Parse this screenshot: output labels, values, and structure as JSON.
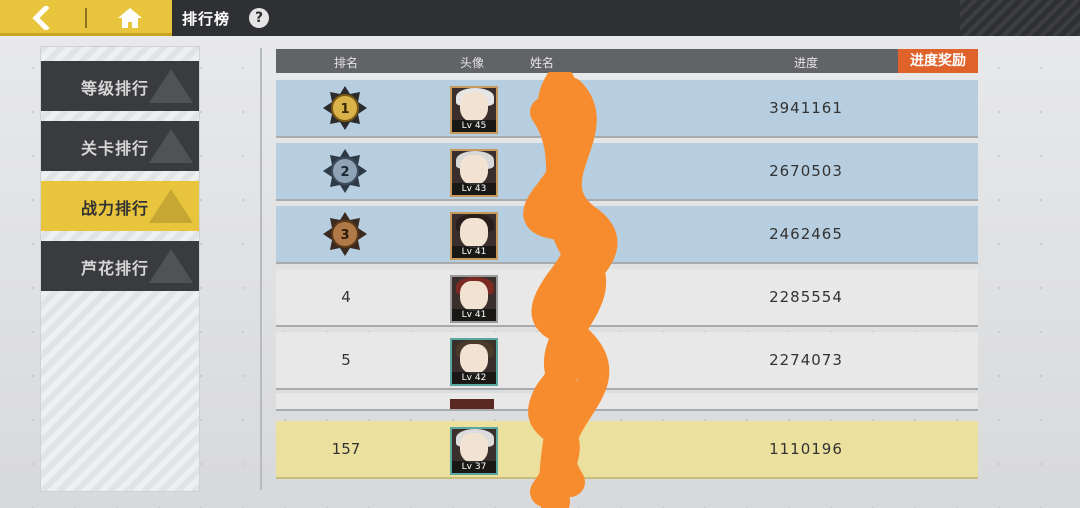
{
  "topbar": {
    "title": "排行榜",
    "help_label": "?",
    "icons": {
      "back": "chevron-left-icon",
      "home": "home-icon"
    }
  },
  "tabs": [
    {
      "label": "等级排行",
      "active": false
    },
    {
      "label": "关卡排行",
      "active": false
    },
    {
      "label": "战力排行",
      "active": true
    },
    {
      "label": "芦花排行",
      "active": false
    }
  ],
  "table": {
    "headers": {
      "rank": "排名",
      "avatar": "头像",
      "name": "姓名",
      "progress": "进度"
    },
    "reward_button": "进度奖励",
    "rows": [
      {
        "rank": "1",
        "medal": "gold",
        "level": "Lv 45",
        "score": "3941161"
      },
      {
        "rank": "2",
        "medal": "silver",
        "level": "Lv 43",
        "score": "2670503"
      },
      {
        "rank": "3",
        "medal": "bronze",
        "level": "Lv 41",
        "score": "2462465"
      },
      {
        "rank": "4",
        "level": "Lv 41",
        "score": "2285554"
      },
      {
        "rank": "5",
        "level": "Lv 42",
        "score": "2274073"
      }
    ],
    "my_row": {
      "rank": "157",
      "level": "Lv 37",
      "score": "1110196"
    }
  },
  "colors": {
    "accent": "#e9c53d",
    "reward": "#e0622b",
    "top_row": "#b6cee0",
    "my_row": "#ece09e",
    "scribble": "#f78c2f"
  }
}
